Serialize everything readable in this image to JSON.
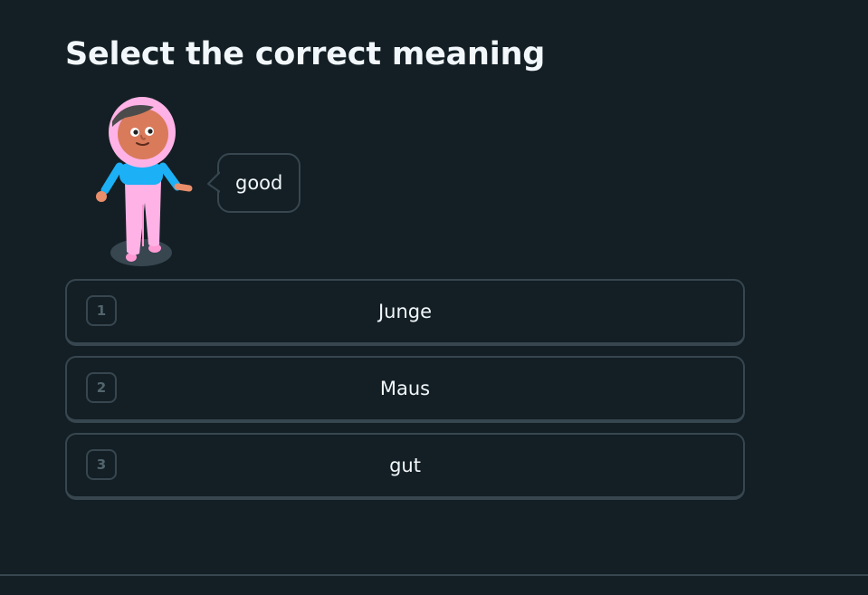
{
  "exercise": {
    "title": "Select the correct meaning",
    "speech_text": "good",
    "character_icon": "character-woman-pink-hijab-icon"
  },
  "options": [
    {
      "key": "1",
      "label": "Junge"
    },
    {
      "key": "2",
      "label": "Maus"
    },
    {
      "key": "3",
      "label": "gut"
    }
  ],
  "colors": {
    "background": "#131f24",
    "border": "#37464f",
    "text": "#f1f7fb",
    "key_text": "#52656d",
    "hijab": "#ffb2e6",
    "top": "#1cb0f6"
  }
}
